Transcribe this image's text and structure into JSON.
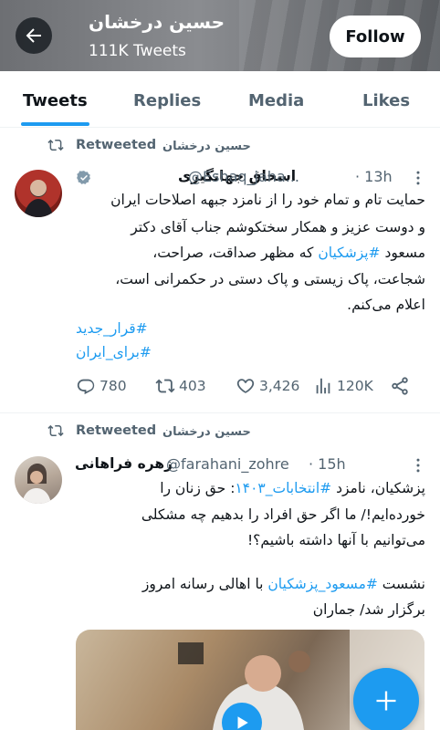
{
  "header": {
    "name": "حسین درخشان",
    "tweet_count": "111K Tweets",
    "follow_label": "Follow"
  },
  "tabs": [
    {
      "label": "Tweets",
      "active": true
    },
    {
      "label": "Replies",
      "active": false
    },
    {
      "label": "Media",
      "active": false
    },
    {
      "label": "Likes",
      "active": false
    }
  ],
  "tweets": [
    {
      "retweeted_by": "حسین درخشان",
      "retweeted_label": "Retweeted",
      "author_name": "اسحاق جهانگیری",
      "verified": true,
      "handle": "@Eshaq_jaha...",
      "time": "· 13h",
      "body": [
        "حمایت تام و تمام خود را از نامزد جبهه اصلاحات ایران",
        "و دوست عزیز و همکار سختکوشم جناب آقای دکتر",
        "مسعود #پزشکیان که مظهر صداقت، صراحت،",
        "شجاعت، پاک زیستی و پاک دستی در حکمرانی است،",
        "اعلام می‌کنم."
      ],
      "hashtags": [
        "#قرار_جدید",
        "#برای_ایران"
      ],
      "stats": {
        "replies": "780",
        "retweets": "403",
        "likes": "3,426",
        "views": "120K"
      }
    },
    {
      "retweeted_by": "حسین درخشان",
      "retweeted_label": "Retweeted",
      "author_name": "زهره فراهانی",
      "verified": false,
      "handle": "@farahani_zohre",
      "time": "· 15h",
      "body": [
        "پزشکیان، نامزد #انتخابات_۱۴۰۳: حق زنان را",
        "خورده‌ایم!/ ما اگر حق افراد را بدهیم چه مشکلی",
        "می‌توانیم با آنها داشته باشیم؟!",
        "",
        "نشست #مسعود_پزشکیان با اهالی رسانه امروز",
        "برگزار شد/ جماران"
      ]
    }
  ],
  "colors": {
    "accent": "#1d9bf0",
    "secondary_text": "#536471",
    "primary_text": "#0f1419"
  },
  "icons": {
    "back": "arrow-left-icon",
    "retweet": "retweet-icon",
    "more": "more-icon",
    "reply": "reply-icon",
    "like": "heart-icon",
    "views": "views-icon",
    "share": "share-icon",
    "compose": "plus-icon",
    "play": "play-icon"
  }
}
